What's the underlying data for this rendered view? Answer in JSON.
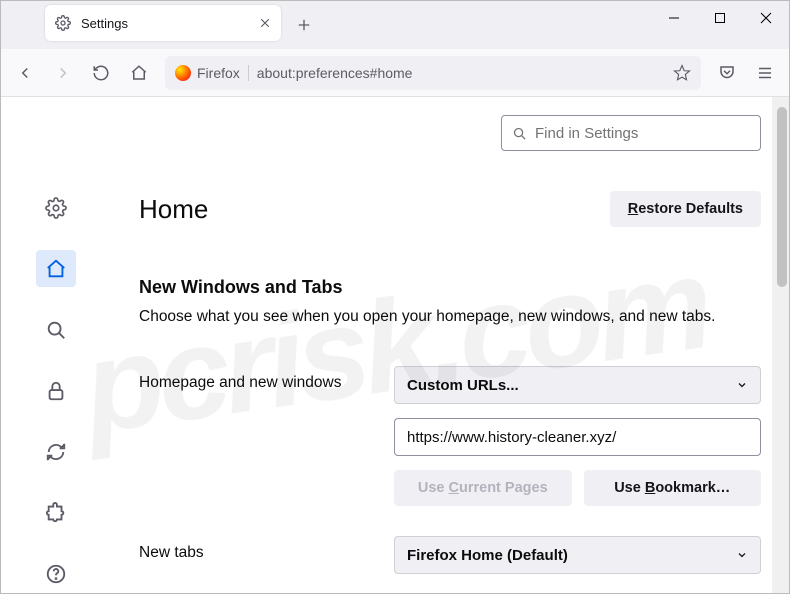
{
  "tab": {
    "title": "Settings"
  },
  "urlbar": {
    "brand": "Firefox",
    "url": "about:preferences#home"
  },
  "search": {
    "placeholder": "Find in Settings"
  },
  "page": {
    "title": "Home",
    "restoreDefaults": "Restore Defaults"
  },
  "section": {
    "title": "New Windows and Tabs",
    "desc": "Choose what you see when you open your homepage, new windows, and new tabs."
  },
  "homepage": {
    "label": "Homepage and new windows",
    "dropdown": "Custom URLs...",
    "value": "https://www.history-cleaner.xyz/",
    "useCurrent": "Use Current Pages",
    "useBookmark": "Use Bookmark…"
  },
  "newtabs": {
    "label": "New tabs",
    "dropdown": "Firefox Home (Default)"
  },
  "watermark": "pcrisk.com"
}
